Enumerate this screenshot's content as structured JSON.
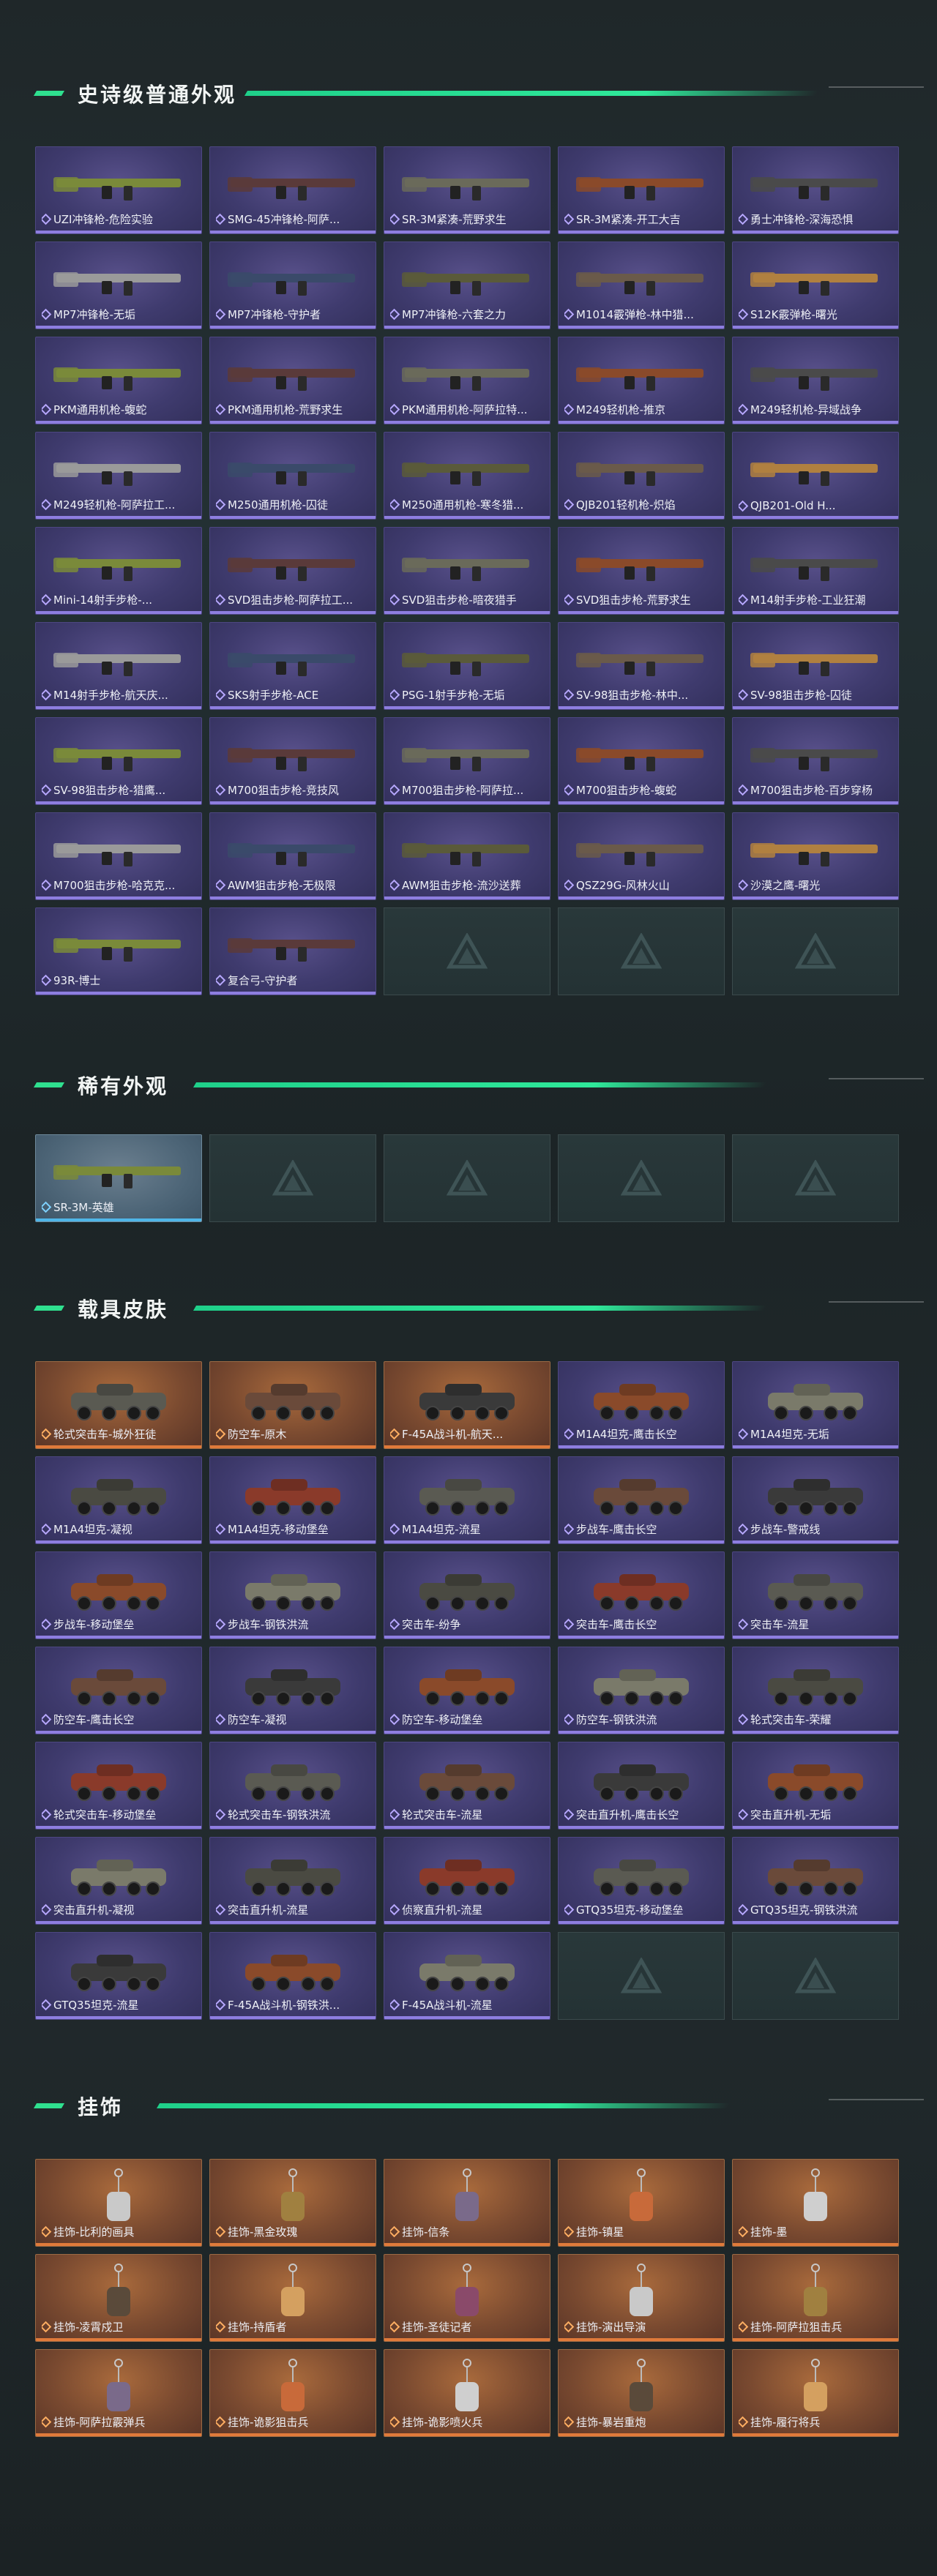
{
  "sections": [
    {
      "title": "史诗级普通外观",
      "items": [
        "UZI冲锋枪-危险实验",
        "SMG-45冲锋枪-阿萨...",
        "SR-3M紧凑-荒野求生",
        "SR-3M紧凑-开工大吉",
        "勇士冲锋枪-深海恐惧",
        "MP7冲锋枪-无垢",
        "MP7冲锋枪-守护者",
        "MP7冲锋枪-六套之力",
        "M1014霰弹枪-林中猎...",
        "S12K霰弹枪-曙光",
        "PKM通用机枪-蝮蛇",
        "PKM通用机枪-荒野求生",
        "PKM通用机枪-阿萨拉特...",
        "M249轻机枪-推京",
        "M249轻机枪-异域战争",
        "M249轻机枪-阿萨拉工...",
        "M250通用机枪-囚徒",
        "M250通用机枪-寒冬猎...",
        "QJB201轻机枪-炽焰",
        "QJB201-Old H...",
        "Mini-14射手步枪-...",
        "SVD狙击步枪-阿萨拉工...",
        "SVD狙击步枪-暗夜猎手",
        "SVD狙击步枪-荒野求生",
        "M14射手步枪-工业狂潮",
        "M14射手步枪-航天庆...",
        "SKS射手步枪-ACE",
        "PSG-1射手步枪-无垢",
        "SV-98狙击步枪-林中...",
        "SV-98狙击步枪-囚徒",
        "SV-98狙击步枪-猎鹰...",
        "M700狙击步枪-竞技风",
        "M700狙击步枪-阿萨拉...",
        "M700狙击步枪-蝮蛇",
        "M700狙击步枪-百步穿杨",
        "M700狙击步枪-哈克克...",
        "AWM狙击步枪-无极限",
        "AWM狙击步枪-流沙送葬",
        "QSZ29G-风林火山",
        "沙漠之鹰-曙光",
        "93R-博士",
        "复合弓-守护者"
      ],
      "slots": 45
    },
    {
      "title": "稀有外观",
      "items": [
        "SR-3M-英雄"
      ],
      "slots": 5
    },
    {
      "title": "载具皮肤",
      "items": [
        "轮式突击车-城外狂徒",
        "防空车-原木",
        "F-45A战斗机-航天...",
        "M1A4坦克-鹰击长空",
        "M1A4坦克-无垢",
        "M1A4坦克-凝视",
        "M1A4坦克-移动堡垒",
        "M1A4坦克-流星",
        "步战车-鹰击长空",
        "步战车-警戒线",
        "步战车-移动堡垒",
        "步战车-钢铁洪流",
        "突击车-纷争",
        "突击车-鹰击长空",
        "突击车-流星",
        "防空车-鹰击长空",
        "防空车-凝视",
        "防空车-移动堡垒",
        "防空车-钢铁洪流",
        "轮式突击车-荣耀",
        "轮式突击车-移动堡垒",
        "轮式突击车-钢铁洪流",
        "轮式突击车-流星",
        "突击直升机-鹰击长空",
        "突击直升机-无垢",
        "突击直升机-凝视",
        "突击直升机-流星",
        "侦察直升机-流星",
        "GTQ35坦克-移动堡垒",
        "GTQ35坦克-钢铁洪流",
        "GTQ35坦克-流星",
        "F-45A战斗机-钢铁洪...",
        "F-45A战斗机-流星"
      ],
      "slots": 35
    },
    {
      "title": "挂饰",
      "items": [
        "挂饰-比利的画具",
        "挂饰-黑金玫瑰",
        "挂饰-信条",
        "挂饰-镇星",
        "挂饰-墨",
        "挂饰-凌霄戍卫",
        "挂饰-持盾者",
        "挂饰-圣徒记者",
        "挂饰-演出导演",
        "挂饰-阿萨拉狙击兵",
        "挂饰-阿萨拉霰弹兵",
        "挂饰-诡影狙击兵",
        "挂饰-诡影喷火兵",
        "挂饰-暴岩重炮",
        "挂饰-履行将兵"
      ],
      "slots": 15
    }
  ],
  "colors": {
    "accent": "#2fe08f",
    "epic": "#8e7ee0",
    "rare": "#4fb6e8",
    "orange": "#e07a3a"
  }
}
